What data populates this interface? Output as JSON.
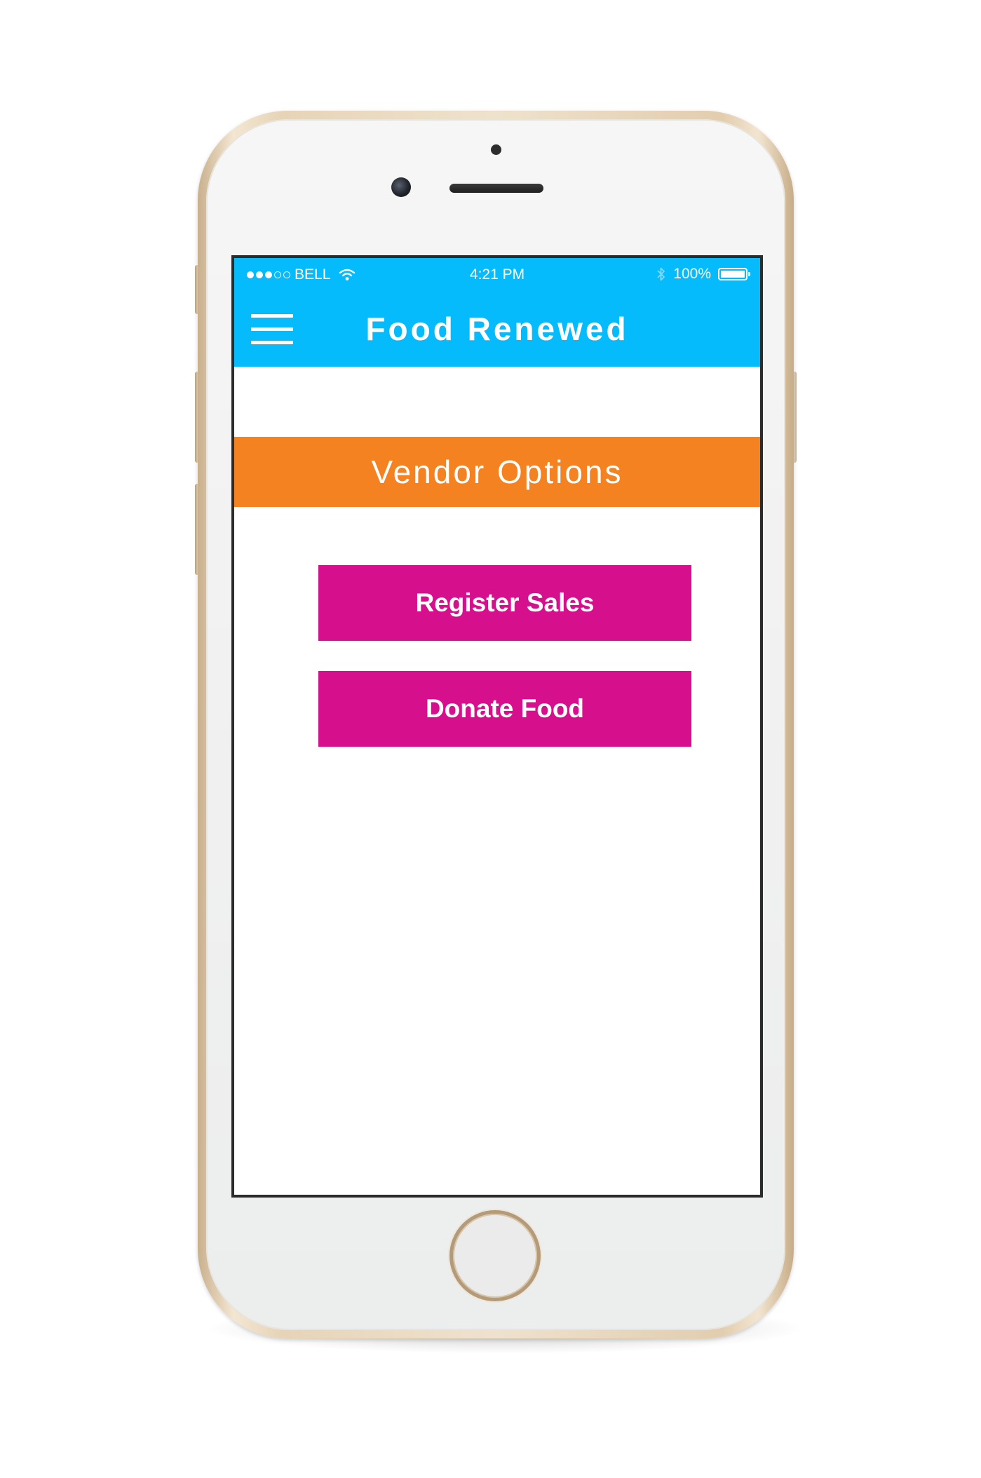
{
  "status_bar": {
    "carrier": "BELL",
    "time": "4:21 PM",
    "battery": "100%",
    "battery_level": 1.0,
    "signal_bars_filled": 3,
    "signal_bars_total": 5,
    "icons": [
      "wifi-icon",
      "bluetooth-icon",
      "battery-icon"
    ]
  },
  "app_bar": {
    "title": "Food Renewed",
    "menu_icon": "hamburger-menu-icon"
  },
  "section": {
    "title": "Vendor Options"
  },
  "actions": {
    "register_sales": "Register Sales",
    "donate_food": "Donate Food"
  },
  "colors": {
    "app_bar": "#05bbfb",
    "section_banner": "#f48221",
    "action_button": "#d60f8c",
    "phone_frame": "#efe2cc"
  }
}
